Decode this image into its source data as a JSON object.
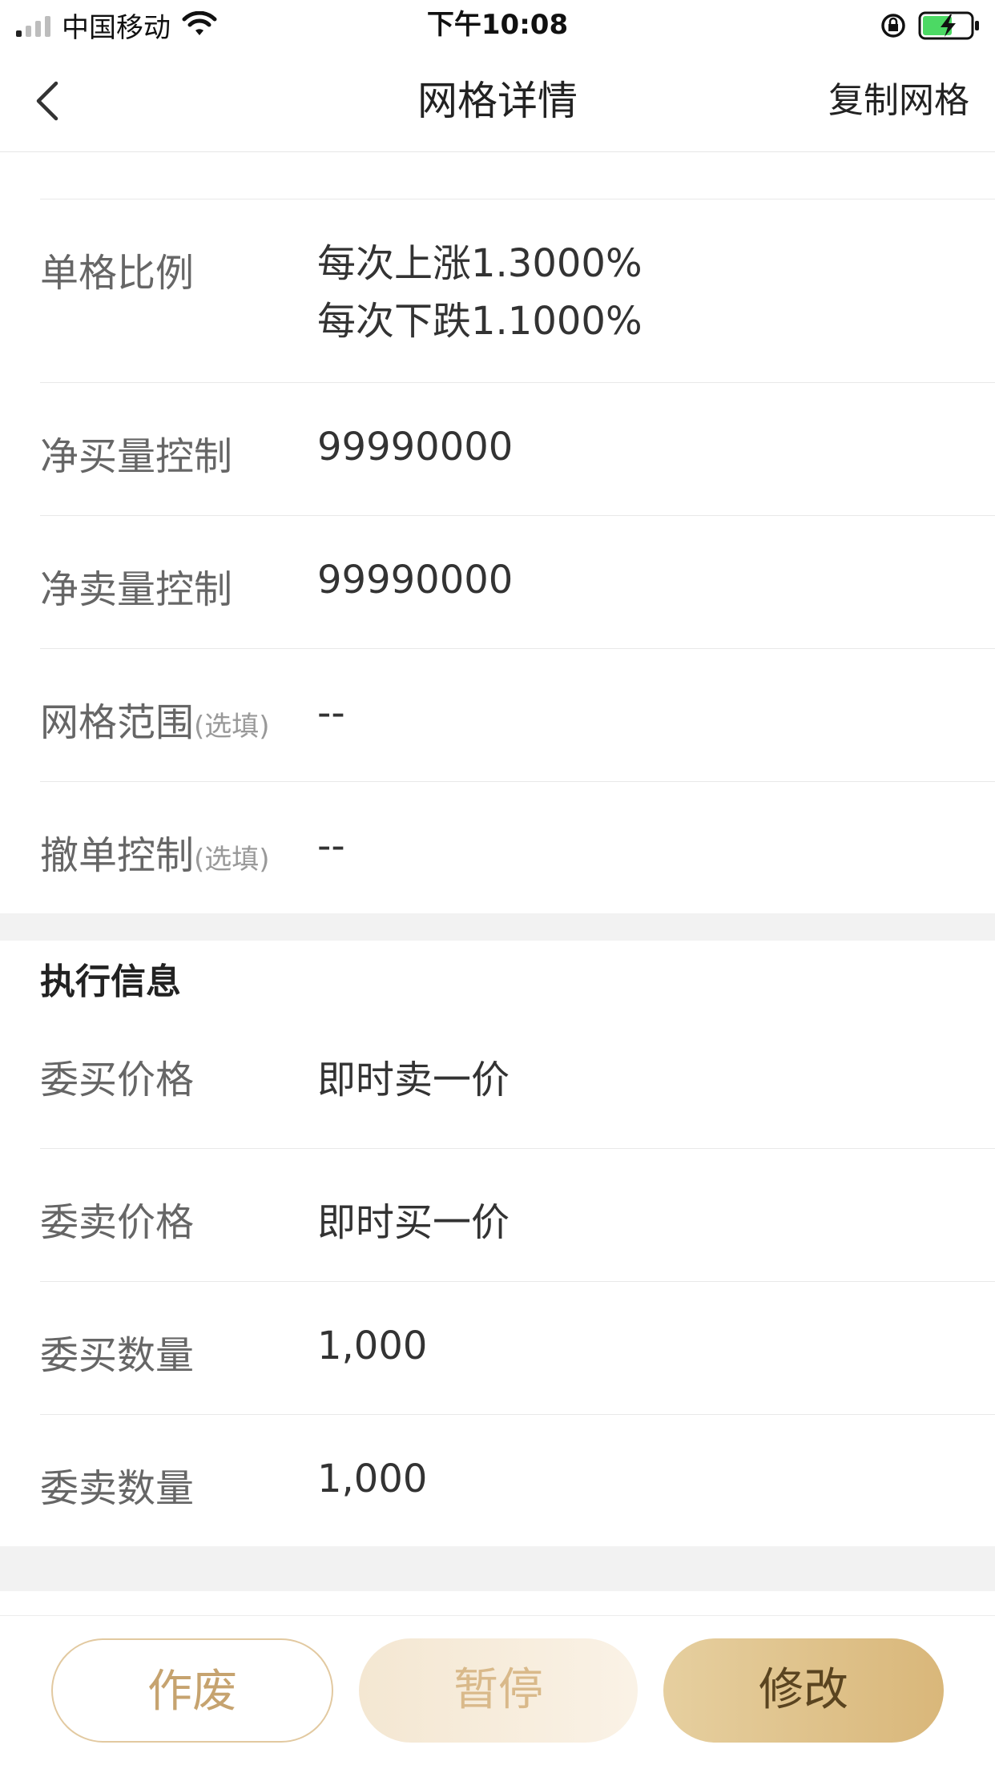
{
  "status_bar": {
    "carrier": "中国移动",
    "time": "下午10:08"
  },
  "nav": {
    "title": "网格详情",
    "action": "复制网格"
  },
  "grid_params": [
    {
      "label": "单格比例",
      "optional": "",
      "values": [
        "每次上涨1.3000%",
        "每次下跌1.1000%"
      ]
    },
    {
      "label": "净买量控制",
      "optional": "",
      "values": [
        "99990000"
      ]
    },
    {
      "label": "净卖量控制",
      "optional": "",
      "values": [
        "99990000"
      ]
    },
    {
      "label": "网格范围",
      "optional": "(选填)",
      "values": [
        "--"
      ]
    },
    {
      "label": "撤单控制",
      "optional": "(选填)",
      "values": [
        "--"
      ]
    }
  ],
  "execution": {
    "title": "执行信息",
    "rows": [
      {
        "label": "委买价格",
        "value": "即时卖一价"
      },
      {
        "label": "委卖价格",
        "value": "即时买一价"
      },
      {
        "label": "委买数量",
        "value": "1,000"
      },
      {
        "label": "委卖数量",
        "value": "1,000"
      }
    ]
  },
  "actions": {
    "void": "作废",
    "pause": "暂停",
    "edit": "修改"
  },
  "colors": {
    "accent_gold": "#d9b77a",
    "accent_text_gold": "#c6a36f",
    "divider": "#e9e9e9",
    "section_gap": "#f2f2f2"
  }
}
